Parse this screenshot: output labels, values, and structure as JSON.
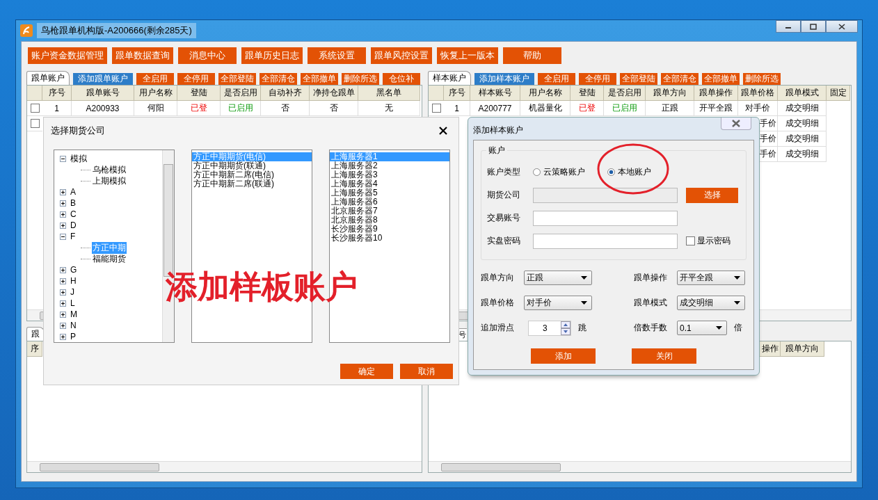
{
  "window": {
    "title": "鸟枪跟单机构版-A200666(剩余285天)"
  },
  "toolbar": [
    "账户资金数据管理",
    "跟单数据查询",
    "消息中心",
    "跟单历史日志",
    "系统设置",
    "跟单风控设置",
    "恢复上一版本",
    "帮助"
  ],
  "follow_panel": {
    "tab": "跟单账户",
    "actions": [
      {
        "label": "添加跟单账户",
        "kind": "primary"
      },
      {
        "label": "全启用",
        "kind": "normal"
      },
      {
        "label": "全停用",
        "kind": "normal"
      },
      {
        "label": "全部登陆",
        "kind": "normal"
      },
      {
        "label": "全部清仓",
        "kind": "normal"
      },
      {
        "label": "全部撤单",
        "kind": "normal"
      },
      {
        "label": "删除所选",
        "kind": "normal"
      },
      {
        "label": "仓位补",
        "kind": "normal"
      }
    ],
    "columns": [
      "序号",
      "跟单账号",
      "用户名称",
      "登陆",
      "是否启用",
      "自动补齐",
      "净持仓跟单",
      "黑名单"
    ],
    "rows": [
      {
        "kind": "full",
        "checked": false,
        "logged_in": true,
        "enabled": true,
        "cells": [
          "1",
          "A200933",
          "何阳",
          "已登",
          "已启用",
          "否",
          "否",
          "无"
        ]
      },
      {
        "kind": "covered",
        "checked": false
      }
    ]
  },
  "sample_panel": {
    "tab": "样本账户",
    "actions": [
      {
        "label": "添加样本账户",
        "kind": "primary"
      },
      {
        "label": "全启用",
        "kind": "normal"
      },
      {
        "label": "全停用",
        "kind": "normal"
      },
      {
        "label": "全部登陆",
        "kind": "normal"
      },
      {
        "label": "全部清仓",
        "kind": "normal"
      },
      {
        "label": "全部撤单",
        "kind": "normal"
      },
      {
        "label": "删除所选",
        "kind": "normal"
      }
    ],
    "columns": [
      "序号",
      "样本账号",
      "用户名称",
      "登陆",
      "是否启用",
      "跟单方向",
      "跟单操作",
      "跟单价格",
      "跟单模式",
      "固定"
    ],
    "rows": [
      {
        "kind": "full",
        "checked": false,
        "logged_in": true,
        "enabled": true,
        "cells": [
          "1",
          "A200777",
          "机器量化",
          "已登",
          "已启用",
          "正跟",
          "开平全跟",
          "对手价",
          "成交明细"
        ]
      },
      {
        "kind": "covered",
        "price": "手价",
        "mode": "成交明细"
      },
      {
        "kind": "covered",
        "price": "手价",
        "mode": "成交明细"
      },
      {
        "kind": "covered",
        "price": "手价",
        "mode": "成交明细"
      }
    ]
  },
  "follow_detail": {
    "tab": "跟",
    "columns": [
      "序"
    ]
  },
  "sample_detail": {
    "tab": "号",
    "columns": [
      "操作",
      "跟单方向"
    ]
  },
  "company_dialog": {
    "title": "选择期货公司",
    "tree": [
      {
        "label": "模拟",
        "expanded": true,
        "selected": false,
        "children": [
          {
            "label": "乌枪模拟",
            "selected": false
          },
          {
            "label": "上期模拟",
            "selected": false
          }
        ]
      },
      {
        "label": "A",
        "expanded": false,
        "selected": false
      },
      {
        "label": "B",
        "expanded": false,
        "selected": false
      },
      {
        "label": "C",
        "expanded": false,
        "selected": false
      },
      {
        "label": "D",
        "expanded": false,
        "selected": false
      },
      {
        "label": "F",
        "expanded": true,
        "selected": false,
        "children": [
          {
            "label": "方正中期",
            "selected": true
          },
          {
            "label": "福能期货",
            "selected": false
          }
        ]
      },
      {
        "label": "G",
        "expanded": false,
        "selected": false
      },
      {
        "label": "H",
        "expanded": false,
        "selected": false
      },
      {
        "label": "J",
        "expanded": false,
        "selected": false
      },
      {
        "label": "L",
        "expanded": false,
        "selected": false
      },
      {
        "label": "M",
        "expanded": false,
        "selected": false
      },
      {
        "label": "N",
        "expanded": false,
        "selected": false
      },
      {
        "label": "P",
        "expanded": false,
        "selected": false
      }
    ],
    "brokers": [
      {
        "label": "方正中期期货(电信)",
        "selected": true
      },
      {
        "label": "方正中期期货(联通)",
        "selected": false
      },
      {
        "label": "方正中期新二席(电信)",
        "selected": false
      },
      {
        "label": "方正中期新二席(联通)",
        "selected": false
      }
    ],
    "servers": [
      {
        "label": "上海服务器1",
        "selected": true
      },
      {
        "label": "上海服务器2",
        "selected": false
      },
      {
        "label": "上海服务器3",
        "selected": false
      },
      {
        "label": "上海服务器4",
        "selected": false
      },
      {
        "label": "上海服务器5",
        "selected": false
      },
      {
        "label": "上海服务器6",
        "selected": false
      },
      {
        "label": "北京服务器7",
        "selected": false
      },
      {
        "label": "北京服务器8",
        "selected": false
      },
      {
        "label": "长沙服务器9",
        "selected": false
      },
      {
        "label": "长沙服务器10",
        "selected": false
      }
    ],
    "buttons": [
      "确定",
      "取消"
    ]
  },
  "sample_dialog": {
    "title": "添加样本账户",
    "group": "账户",
    "account_type_label": "账户类型",
    "account_types": [
      {
        "label": "云策略账户",
        "selected": false
      },
      {
        "label": "本地账户",
        "selected": true
      }
    ],
    "fields": [
      {
        "label": "期货公司",
        "disabled": true
      },
      {
        "label": "交易账号",
        "disabled": false
      },
      {
        "label": "实盘密码",
        "disabled": false
      }
    ],
    "choose_button": "选择",
    "show_password": {
      "label": "显示密码",
      "checked": false
    },
    "selects": [
      {
        "label": "跟单方向",
        "value": "正跟"
      },
      {
        "label": "跟单操作",
        "value": "开平全跟"
      },
      {
        "label": "跟单价格",
        "value": "对手价"
      },
      {
        "label": "跟单模式",
        "value": "成交明细"
      }
    ],
    "slippage": {
      "label": "追加滑点",
      "value": "3",
      "unit": "跳"
    },
    "multiplier": {
      "label": "倍数手数",
      "value": "0.1",
      "unit": "倍"
    },
    "buttons": [
      "添加",
      "关闭"
    ]
  },
  "annotation": {
    "text": "添加样板账户"
  }
}
